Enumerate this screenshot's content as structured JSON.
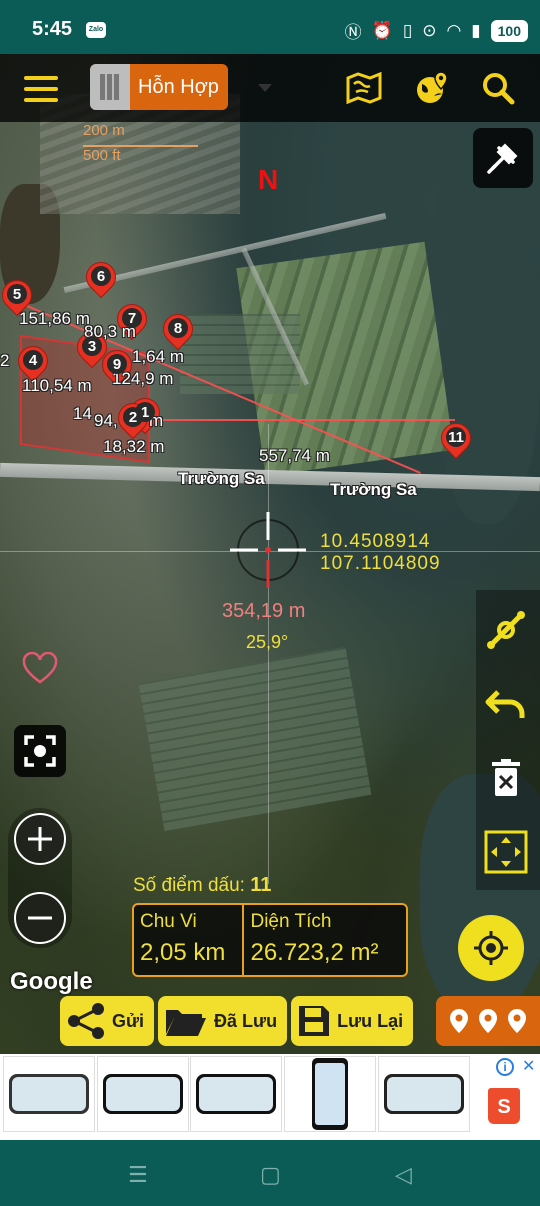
{
  "status_bar": {
    "time": "5:45",
    "app_notification": "Zalo",
    "battery": "100"
  },
  "toolbar": {
    "map_type_label": "Hỗn Hợp"
  },
  "scale": {
    "metric": "200 m",
    "imperial": "500 ft"
  },
  "compass": {
    "north_label": "N"
  },
  "markers": [
    {
      "number": "1"
    },
    {
      "number": "2"
    },
    {
      "number": "3"
    },
    {
      "number": "4"
    },
    {
      "number": "5"
    },
    {
      "number": "6"
    },
    {
      "number": "7"
    },
    {
      "number": "8"
    },
    {
      "number": "9"
    },
    {
      "number": "11"
    }
  ],
  "segment_distances": [
    "151,86 m",
    "80,3 m",
    "1,64 m",
    "2",
    "110,54 m",
    "124,9 m",
    "14",
    "94,",
    "m",
    "18,32 m",
    "557,74 m"
  ],
  "roads": [
    "Trường Sa",
    "Trường Sa"
  ],
  "cursor": {
    "latitude": "10.4508914",
    "longitude": "107.1104809",
    "distance": "354,19 m",
    "bearing": "25,9°"
  },
  "measurement": {
    "points_label": "Số điểm dấu:",
    "points_count": "11",
    "perimeter_label": "Chu Vi",
    "perimeter_value": "2,05 km",
    "area_label": "Diện Tích",
    "area_value": "26.723,2 m²"
  },
  "attribution": "Google",
  "actions": {
    "send": "Gửi",
    "saved": "Đã Lưu",
    "save": "Lưu Lại"
  },
  "colors": {
    "accent_yellow": "#f0df1f",
    "accent_orange": "#d9660e",
    "marker_red": "#e53022",
    "statusbar_teal": "#0b5c56"
  },
  "icons": {
    "menu": "hamburger-icon",
    "map_book": "map-icon",
    "globe": "globe-pin-icon",
    "search": "search-icon",
    "gps_off": "gps-off-icon",
    "path": "path-edit-icon",
    "undo": "undo-icon",
    "delete": "trash-icon",
    "fit": "fit-bounds-icon",
    "locate": "my-location-icon"
  }
}
